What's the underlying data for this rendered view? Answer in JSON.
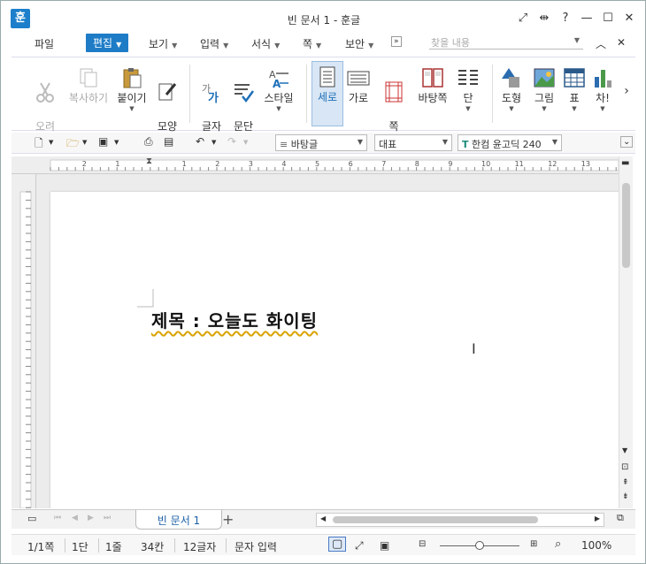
{
  "app": {
    "logo": "훈",
    "title": "빈 문서 1 - 훈글"
  },
  "window_buttons": [
    "⤢",
    "⇹",
    "?",
    "—",
    "☐",
    "✕"
  ],
  "menu": {
    "items": [
      "파일",
      "편집",
      "보기",
      "입력",
      "서식",
      "쪽",
      "보안"
    ],
    "search_placeholder": "찾을 내용",
    "expand": "»"
  },
  "ribbon": {
    "cut": "오려\n두기",
    "copy": "복사하기",
    "paste": "붙이기",
    "format_copy": "모양\n복사",
    "char_shape": "글자\n모양",
    "para_shape": "문단\n모양",
    "style": "스타일",
    "portrait": "세로",
    "landscape": "가로",
    "margin": "쪽\n여백",
    "bg": "바탕쪽",
    "column": "단",
    "shape": "도형",
    "picture": "그림",
    "table": "표",
    "chart": "차!",
    "more": "›"
  },
  "toolbar2": {
    "style_combo": "바탕글",
    "lang_combo": "대표",
    "font_combo": "한컴 윤고딕 240",
    "font_badge": "T"
  },
  "ruler": {
    "ticks": [
      "2",
      "1",
      "1",
      "2",
      "3",
      "4",
      "5",
      "6",
      "7",
      "8",
      "9",
      "10",
      "11",
      "12",
      "13"
    ]
  },
  "document": {
    "text": "제목 : 오늘도 화이팅"
  },
  "tabs": {
    "active": "빈 문서 1",
    "add": "+"
  },
  "status": {
    "page": "1/1쪽",
    "col": "1단",
    "line": "1줄",
    "pos": "34칸",
    "chars": "12글자",
    "mode": "문자 입력",
    "zoom": "100%"
  }
}
